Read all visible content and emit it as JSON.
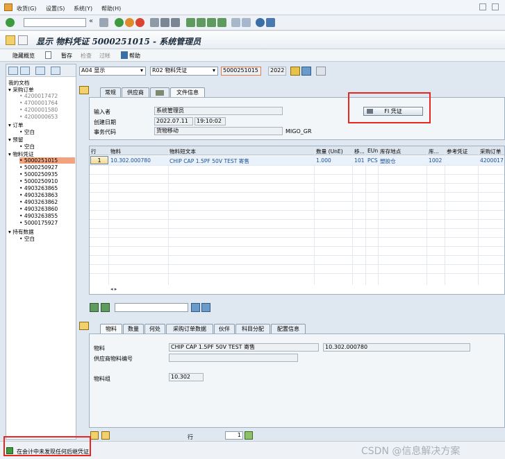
{
  "menu": [
    "收货(G)",
    "设置(S)",
    "系统(Y)",
    "帮助(H)"
  ],
  "title": "显示 物料凭证 5000251015 - 系统管理员",
  "appbar": {
    "overview": "隐藏概览",
    "hold": "暂存",
    "check": "检查",
    "post": "过帐",
    "help": "帮助"
  },
  "header": {
    "action": "A04 显示",
    "reference": "R02 物料凭证",
    "doc_number": "5000251015",
    "year": "2022"
  },
  "tree": {
    "root": "我的文档",
    "groups": [
      {
        "label": "采购订单",
        "items": [
          "4200017472",
          "4700001764",
          "4200001580",
          "4200000653"
        ]
      },
      {
        "label": "订单",
        "items": [
          "空白"
        ]
      },
      {
        "label": "预留",
        "items": [
          "空白"
        ]
      },
      {
        "label": "物料凭证",
        "items": [
          "5000251015",
          "5000250927",
          "5000250935",
          "5000250910",
          "4903263865",
          "4903263863",
          "4903263862",
          "4903263860",
          "4903263855",
          "5000175927"
        ]
      },
      {
        "label": "持有数据",
        "items": [
          "空白"
        ]
      }
    ],
    "selected": "5000251015"
  },
  "header_tabs": [
    "常规",
    "供应商",
    "",
    "文件信息"
  ],
  "general": {
    "entered_by_label": "输入者",
    "entered_by": "系统管理员",
    "created_label": "创建日期",
    "created_date": "2022.07.11",
    "created_time": "19:10:02",
    "tcode_label": "事务代码",
    "tcode_text": "货物移动",
    "tcode": "MIGO_GR",
    "fi_button": "FI 凭证"
  },
  "items_table": {
    "columns": [
      "行",
      "物料",
      "物料短文本",
      "数量 (UnE)",
      "移...",
      "EUn",
      "库存地点",
      "库...",
      "参考凭证",
      "采购订单"
    ],
    "rows": [
      [
        "1",
        "10.302.000780",
        "CHIP CAP 1.5PF 50V TEST 寄售",
        "1.000",
        "101",
        "PCS",
        "塑胶仓",
        "1002",
        "",
        "4200017"
      ]
    ]
  },
  "detail_tabs": [
    "物料",
    "数量",
    "何处",
    "采购订单数据",
    "伙伴",
    "科目分配",
    "配置信息"
  ],
  "detail": {
    "material_label": "物料",
    "material_text": "CHIP CAP 1.5PF 50V TEST 寄售",
    "material_no": "10.302.000780",
    "vendor_mat_label": "供应商物料编号",
    "vendor_mat": "",
    "mat_group_label": "物料组",
    "mat_group": "10.302"
  },
  "footer": {
    "row_label": "行",
    "row_value": "1"
  },
  "status": {
    "checkbox_label": "在会计中未发现任何后继凭证",
    "watermark": "CSDN @信息解决方案"
  },
  "colors": {
    "highlight": "#e8251f",
    "selected_row": "#f2a27c",
    "link": "#1d4f91"
  }
}
